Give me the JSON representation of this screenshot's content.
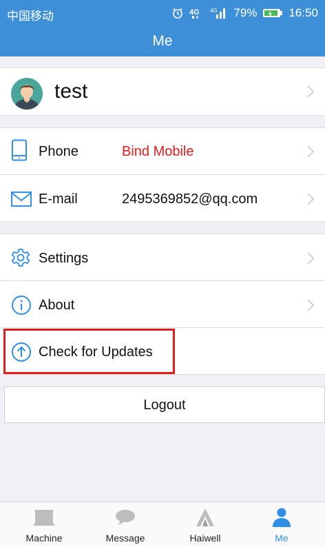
{
  "statusbar": {
    "carrier": "中国移动",
    "battery": "79%",
    "time": "16:50"
  },
  "header": {
    "title": "Me"
  },
  "profile": {
    "username": "test"
  },
  "account": [
    {
      "label": "Phone",
      "value": "Bind Mobile"
    },
    {
      "label": "E-mail",
      "value": "2495369852@qq.com"
    }
  ],
  "menu": [
    {
      "label": "Settings"
    },
    {
      "label": "About"
    },
    {
      "label": "Check for Updates"
    }
  ],
  "logout_label": "Logout",
  "tabs": [
    {
      "label": "Machine",
      "icon": "monitor-icon"
    },
    {
      "label": "Message",
      "icon": "chat-bubble-icon"
    },
    {
      "label": "Haiwell",
      "icon": "haiwell-logo-icon"
    },
    {
      "label": "Me",
      "icon": "person-icon",
      "active": true
    }
  ],
  "colors": {
    "header": "#3d8fd8",
    "accent": "#2e8fe4",
    "warning_text": "#e41a1a",
    "highlight_box": "#e31b1b"
  }
}
